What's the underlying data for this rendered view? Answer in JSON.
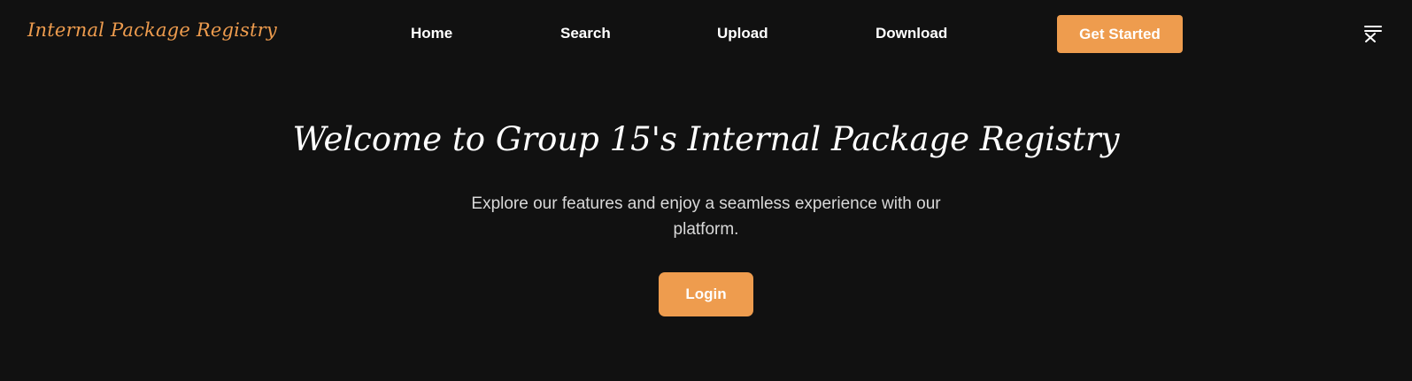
{
  "brand": {
    "name": "Internal Package Registry",
    "color": "#ee9c4e"
  },
  "nav": {
    "items": [
      {
        "label": "Home"
      },
      {
        "label": "Search"
      },
      {
        "label": "Upload"
      },
      {
        "label": "Download"
      }
    ],
    "cta_label": "Get Started",
    "menu_icon": "menu-close-icon"
  },
  "hero": {
    "title": "Welcome to Group 15's Internal Package Registry",
    "subtitle": "Explore our features and enjoy a seamless experience with our platform.",
    "login_label": "Login"
  },
  "colors": {
    "background": "#111111",
    "accent": "#ee9c4e",
    "text": "#ffffff",
    "muted_text": "#d9d9d9"
  }
}
